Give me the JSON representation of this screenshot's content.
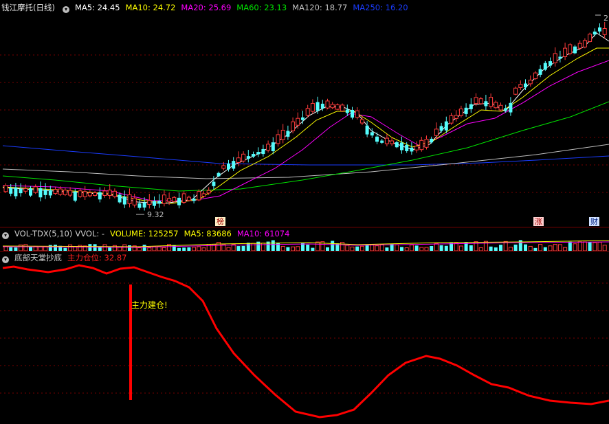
{
  "main_header": {
    "title": "钱江摩托(日线)",
    "ma5": "MA5: 24.45",
    "ma10": "MA10: 24.72",
    "ma20": "MA20: 25.69",
    "ma60": "MA60: 23.13",
    "ma120": "MA120: 18.77",
    "ma250": "MA250: 16.20"
  },
  "price_labels": {
    "low": "9.32",
    "high_partial": "2"
  },
  "event_tags": {
    "bang": "榜",
    "zhang": "涨",
    "cai": "财"
  },
  "vol_header": {
    "title": "VOL-TDX(5,10)",
    "vvol": "VVOL: -",
    "volume": "VOLUME: 125257",
    "ma5": "MA5: 83686",
    "ma10": "MA10: 61074"
  },
  "ind_header": {
    "title": "底部天堂抄底",
    "value": "主力仓位: 32.87"
  },
  "annotation": "主力建仓!",
  "colors": {
    "up": "#ff3c3c",
    "down": "#54fcfc",
    "ma5": "#ffffff",
    "ma10": "#ffff00",
    "ma20": "#ff00ff",
    "ma60": "#00e600",
    "ma120": "#c0c0c0",
    "ma250": "#1a3cff",
    "indicator": "#ff0000",
    "grid": "#7a0000"
  }
}
